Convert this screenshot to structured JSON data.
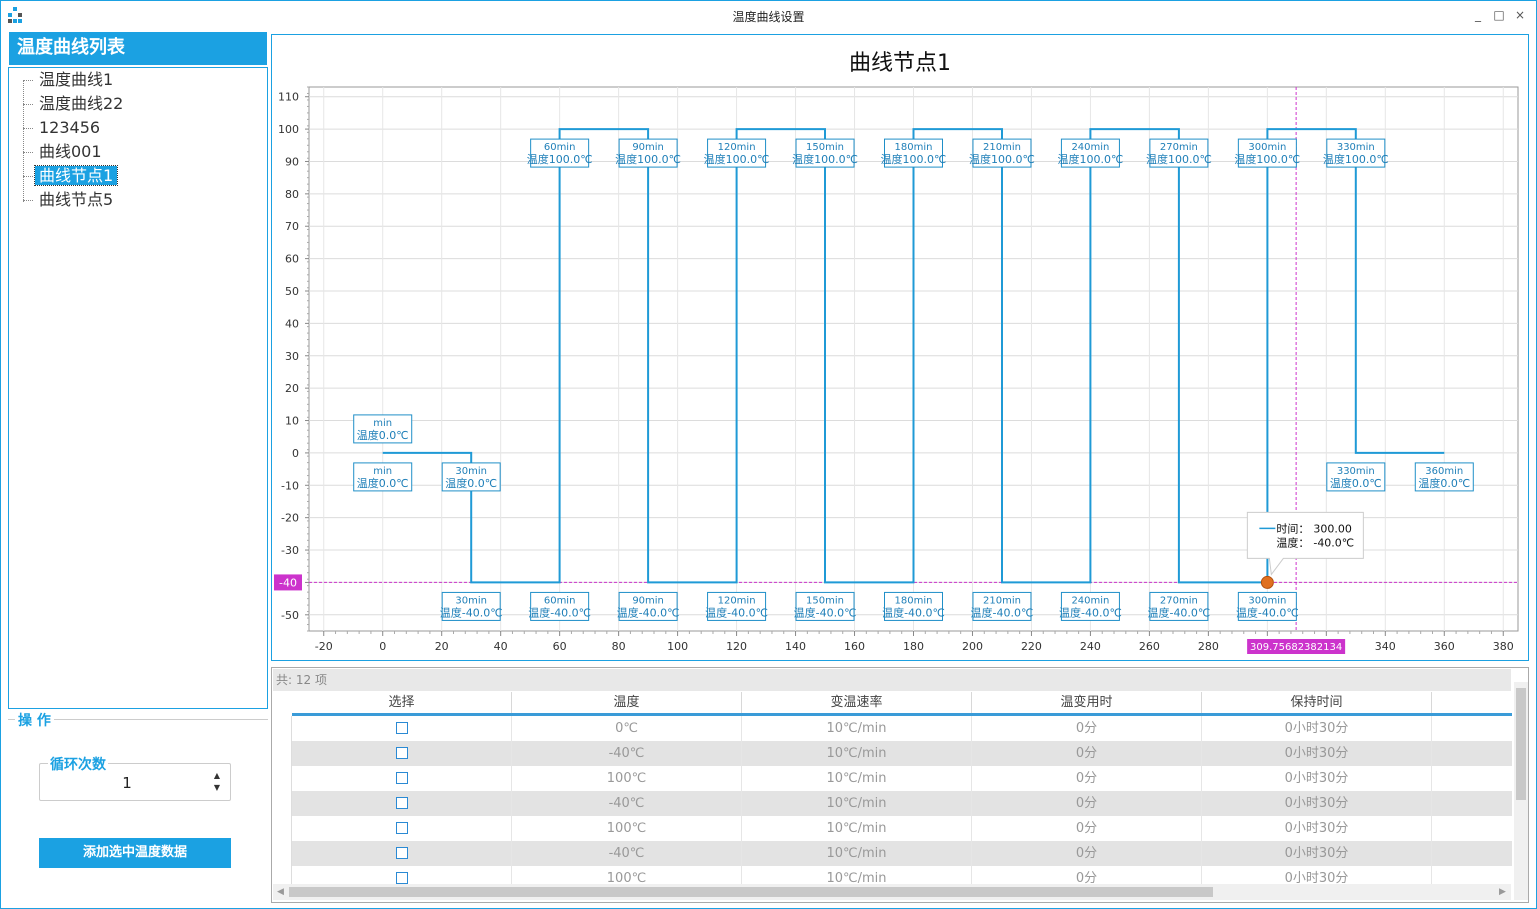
{
  "window": {
    "title": "温度曲线设置",
    "buttons": [
      "_",
      "□",
      "×"
    ]
  },
  "sidebar": {
    "header": "温度曲线列表",
    "items": [
      {
        "label": "温度曲线1",
        "selected": false
      },
      {
        "label": "温度曲线22",
        "selected": false
      },
      {
        "label": "123456",
        "selected": false
      },
      {
        "label": "曲线001",
        "selected": false
      },
      {
        "label": "曲线节点1",
        "selected": true
      },
      {
        "label": "曲线节点5",
        "selected": false
      }
    ]
  },
  "operations": {
    "legend": "操 作",
    "loop_label": "循环次数",
    "loop_value": "1",
    "add_button": "添加选中温度数据"
  },
  "chart_data": {
    "type": "line",
    "title": "曲线节点1",
    "xlim": [
      -25,
      385
    ],
    "ylim": [
      -55,
      113
    ],
    "x_ticks": [
      -20,
      0,
      20,
      40,
      60,
      80,
      100,
      120,
      140,
      160,
      180,
      200,
      220,
      240,
      260,
      280,
      300,
      320,
      340,
      360,
      380
    ],
    "y_ticks": [
      -50,
      -40,
      -30,
      -20,
      -10,
      0,
      10,
      20,
      30,
      40,
      50,
      60,
      70,
      80,
      90,
      100,
      110
    ],
    "grid": true,
    "series_color": "#1f9ad6",
    "points": [
      [
        0,
        0
      ],
      [
        30,
        0
      ],
      [
        30,
        -40
      ],
      [
        60,
        -40
      ],
      [
        60,
        100
      ],
      [
        90,
        100
      ],
      [
        90,
        -40
      ],
      [
        120,
        -40
      ],
      [
        120,
        100
      ],
      [
        150,
        100
      ],
      [
        150,
        -40
      ],
      [
        180,
        -40
      ],
      [
        180,
        100
      ],
      [
        210,
        100
      ],
      [
        210,
        -40
      ],
      [
        240,
        -40
      ],
      [
        240,
        100
      ],
      [
        270,
        100
      ],
      [
        270,
        -40
      ],
      [
        300,
        -40
      ],
      [
        300,
        100
      ],
      [
        330,
        100
      ],
      [
        330,
        0
      ],
      [
        360,
        0
      ]
    ],
    "annotations": [
      {
        "x": 0,
        "y": 0,
        "pos": "above",
        "line1": "min",
        "line2": "温度0.0℃"
      },
      {
        "x": 0,
        "y": 0,
        "pos": "below",
        "line1": "min",
        "line2": "温度0.0℃"
      },
      {
        "x": 30,
        "y": 0,
        "pos": "below",
        "line1": "30min",
        "line2": "温度0.0℃"
      },
      {
        "x": 30,
        "y": -40,
        "pos": "below",
        "line1": "30min",
        "line2": "温度-40.0℃"
      },
      {
        "x": 60,
        "y": -40,
        "pos": "below",
        "line1": "60min",
        "line2": "温度-40.0℃"
      },
      {
        "x": 90,
        "y": -40,
        "pos": "below",
        "line1": "90min",
        "line2": "温度-40.0℃"
      },
      {
        "x": 120,
        "y": -40,
        "pos": "below",
        "line1": "120min",
        "line2": "温度-40.0℃"
      },
      {
        "x": 150,
        "y": -40,
        "pos": "below",
        "line1": "150min",
        "line2": "温度-40.0℃"
      },
      {
        "x": 180,
        "y": -40,
        "pos": "below",
        "line1": "180min",
        "line2": "温度-40.0℃"
      },
      {
        "x": 210,
        "y": -40,
        "pos": "below",
        "line1": "210min",
        "line2": "温度-40.0℃"
      },
      {
        "x": 240,
        "y": -40,
        "pos": "below",
        "line1": "240min",
        "line2": "温度-40.0℃"
      },
      {
        "x": 270,
        "y": -40,
        "pos": "below",
        "line1": "270min",
        "line2": "温度-40.0℃"
      },
      {
        "x": 300,
        "y": -40,
        "pos": "below",
        "line1": "300min",
        "line2": "温度-40.0℃"
      },
      {
        "x": 60,
        "y": 100,
        "pos": "below",
        "line1": "60min",
        "line2": "温度100.0℃"
      },
      {
        "x": 90,
        "y": 100,
        "pos": "below",
        "line1": "90min",
        "line2": "温度100.0℃"
      },
      {
        "x": 120,
        "y": 100,
        "pos": "below",
        "line1": "120min",
        "line2": "温度100.0℃"
      },
      {
        "x": 150,
        "y": 100,
        "pos": "below",
        "line1": "150min",
        "line2": "温度100.0℃"
      },
      {
        "x": 180,
        "y": 100,
        "pos": "below",
        "line1": "180min",
        "line2": "温度100.0℃"
      },
      {
        "x": 210,
        "y": 100,
        "pos": "below",
        "line1": "210min",
        "line2": "温度100.0℃"
      },
      {
        "x": 240,
        "y": 100,
        "pos": "below",
        "line1": "240min",
        "line2": "温度100.0℃"
      },
      {
        "x": 270,
        "y": 100,
        "pos": "below",
        "line1": "270min",
        "line2": "温度100.0℃"
      },
      {
        "x": 300,
        "y": 100,
        "pos": "below",
        "line1": "300min",
        "line2": "温度100.0℃"
      },
      {
        "x": 330,
        "y": 100,
        "pos": "below",
        "line1": "330min",
        "line2": "温度100.0℃"
      },
      {
        "x": 330,
        "y": 0,
        "pos": "below",
        "line1": "330min",
        "line2": "温度0.0℃"
      },
      {
        "x": 360,
        "y": 0,
        "pos": "below",
        "line1": "360min",
        "line2": "温度0.0℃"
      }
    ],
    "crosshair": {
      "x": 309.75682382134,
      "y": -40,
      "x_label": "309.75682382134",
      "y_label": "-40",
      "color": "#cc33cc"
    },
    "marker": {
      "x": 300,
      "y": -40,
      "color": "#e07020"
    },
    "tooltip": {
      "time_label": "时间：",
      "time_value": "300.00",
      "temp_label": "温度：",
      "temp_value": "-40.0℃"
    }
  },
  "table": {
    "count_text": "共: 12 项",
    "columns": [
      "选择",
      "温度",
      "变温速率",
      "温变用时",
      "保持时间"
    ],
    "rows": [
      {
        "temp": "0℃",
        "rate": "10℃/min",
        "duration": "0分",
        "hold": "0小时30分"
      },
      {
        "temp": "-40℃",
        "rate": "10℃/min",
        "duration": "0分",
        "hold": "0小时30分"
      },
      {
        "temp": "100℃",
        "rate": "10℃/min",
        "duration": "0分",
        "hold": "0小时30分"
      },
      {
        "temp": "-40℃",
        "rate": "10℃/min",
        "duration": "0分",
        "hold": "0小时30分"
      },
      {
        "temp": "100℃",
        "rate": "10℃/min",
        "duration": "0分",
        "hold": "0小时30分"
      },
      {
        "temp": "-40℃",
        "rate": "10℃/min",
        "duration": "0分",
        "hold": "0小时30分"
      },
      {
        "temp": "100℃",
        "rate": "10℃/min",
        "duration": "0分",
        "hold": "0小时30分"
      }
    ]
  }
}
